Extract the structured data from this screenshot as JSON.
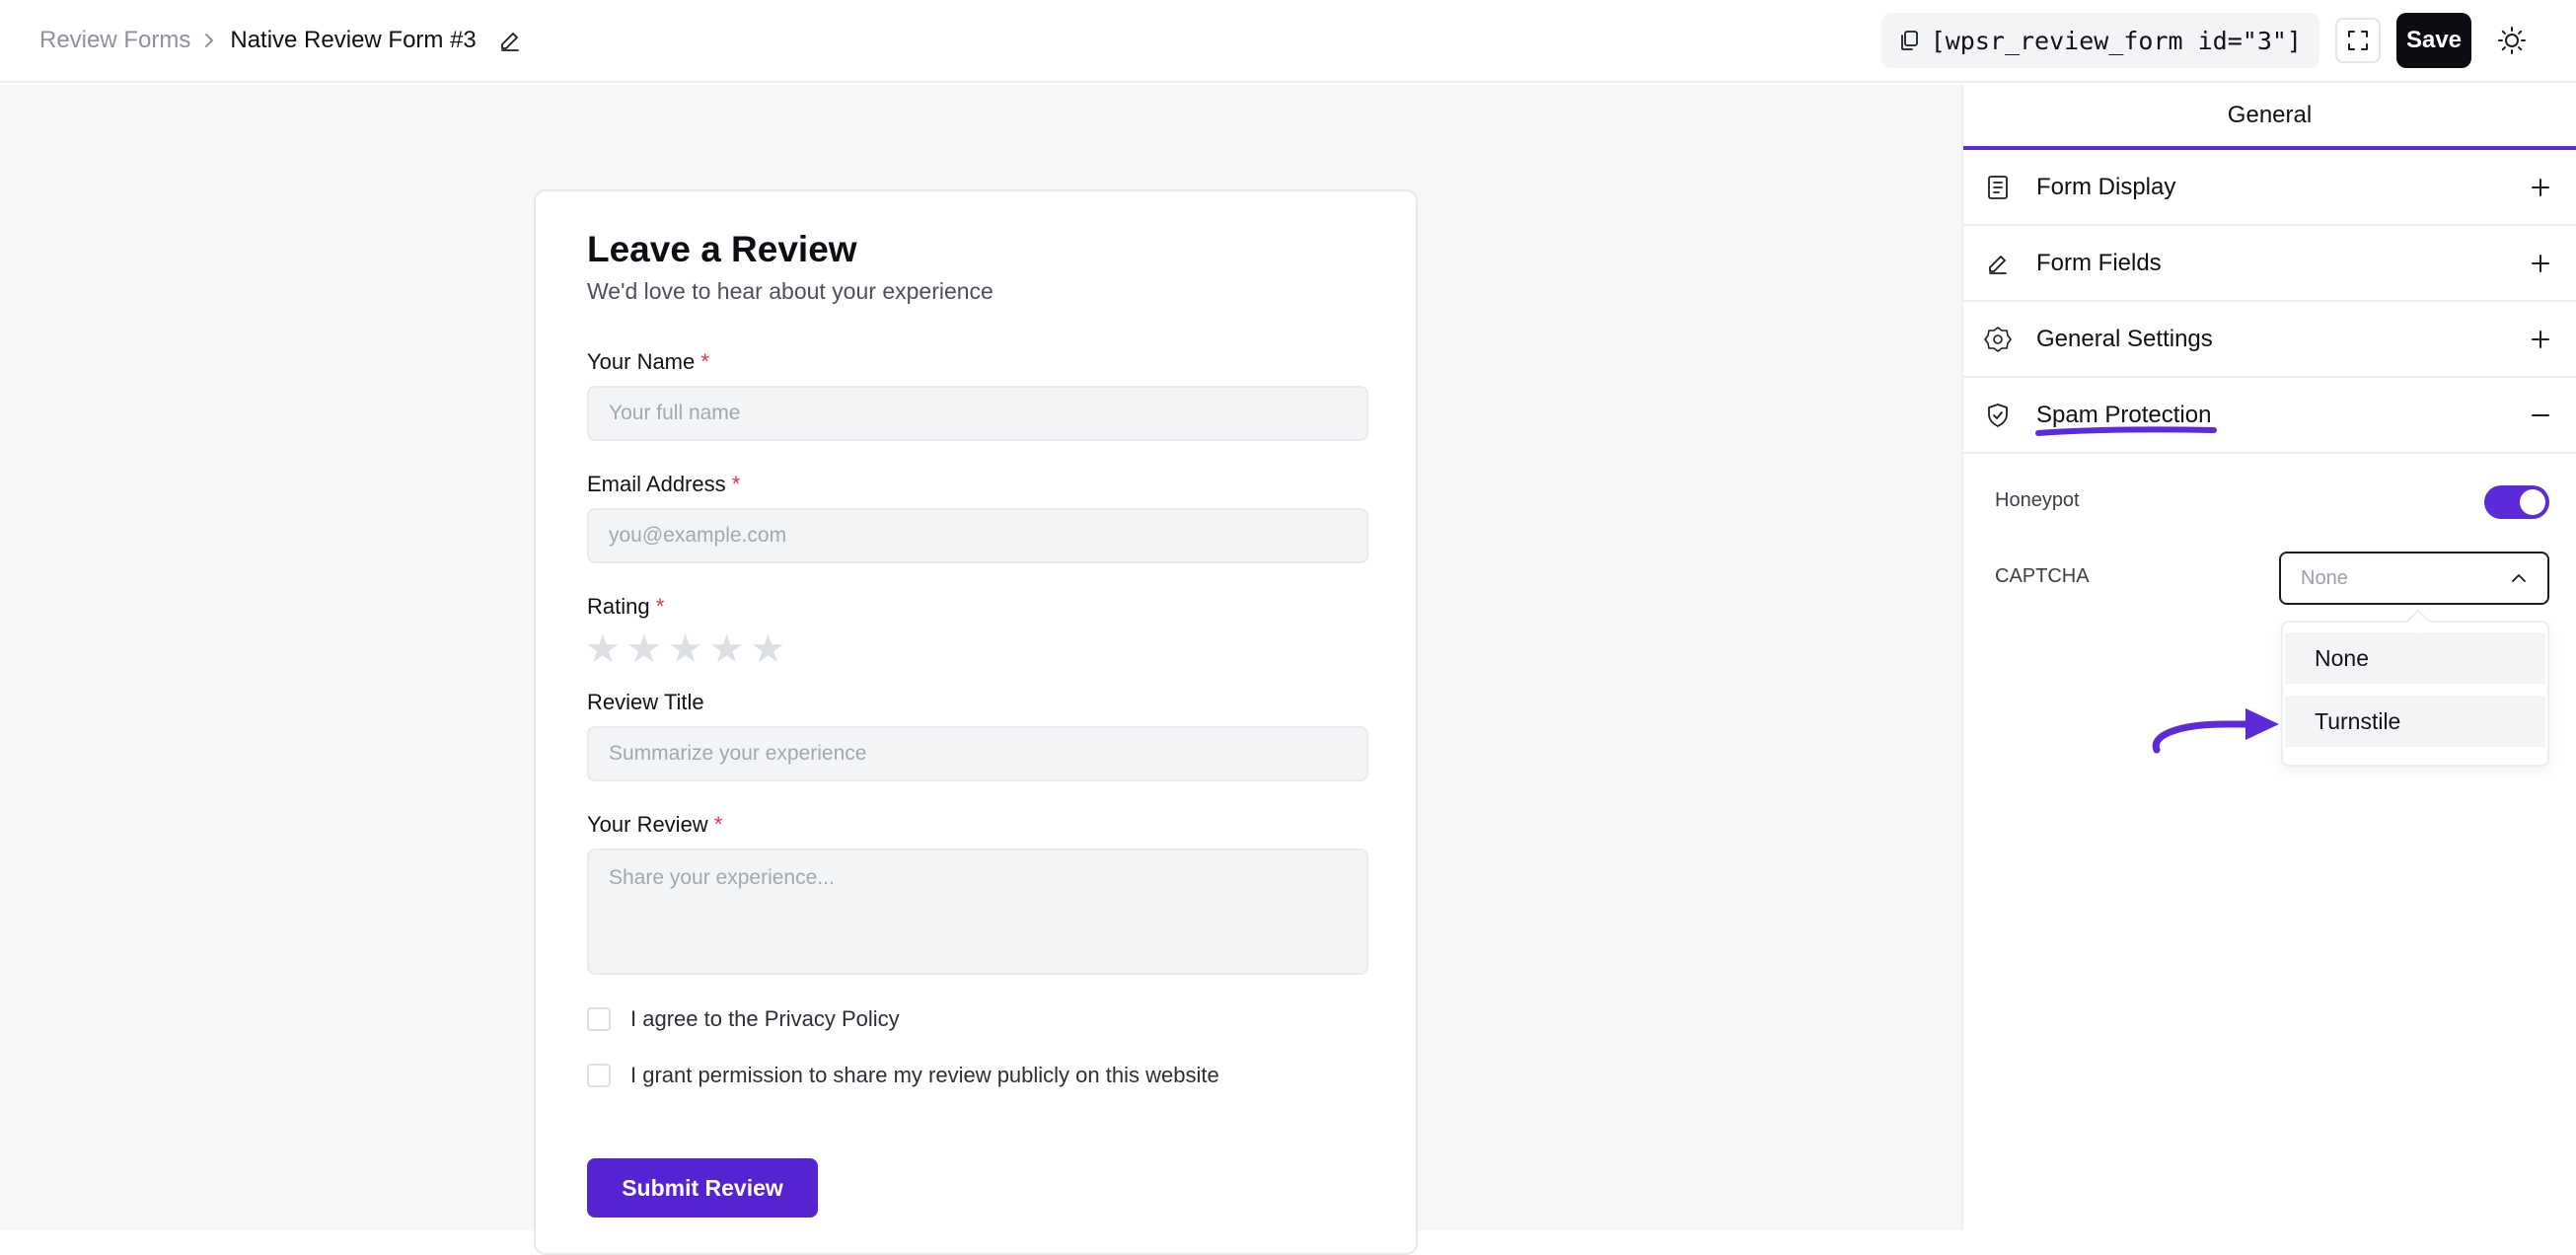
{
  "header": {
    "breadcrumb_parent": "Review Forms",
    "breadcrumb_current": "Native Review Form #3",
    "shortcode": "[wpsr_review_form id=\"3\"]",
    "save_label": "Save"
  },
  "form": {
    "title": "Leave a Review",
    "subtitle": "We'd love to hear about your experience",
    "name_label": "Your Name",
    "name_placeholder": "Your full name",
    "email_label": "Email Address",
    "email_placeholder": "you@example.com",
    "rating_label": "Rating",
    "rating_value": 0,
    "rating_max": 5,
    "title_label": "Review Title",
    "title_placeholder": "Summarize your experience",
    "review_label": "Your Review",
    "review_placeholder": "Share your experience...",
    "required_mark": "*",
    "privacy_label": "I agree to the Privacy Policy",
    "permission_label": "I grant permission to share my review publicly on this website",
    "submit_label": "Submit Review"
  },
  "panel": {
    "tab": "General",
    "sections": {
      "form_display": "Form Display",
      "form_fields": "Form Fields",
      "general_settings": "General Settings",
      "spam_protection": "Spam Protection"
    },
    "honeypot_label": "Honeypot",
    "honeypot_on": true,
    "captcha_label": "CAPTCHA",
    "captcha_selected": "None",
    "captcha_options": [
      "None",
      "Turnstile"
    ]
  },
  "colors": {
    "accent": "#5a2bd6",
    "submit": "#5424d3",
    "required": "#e0344a"
  }
}
